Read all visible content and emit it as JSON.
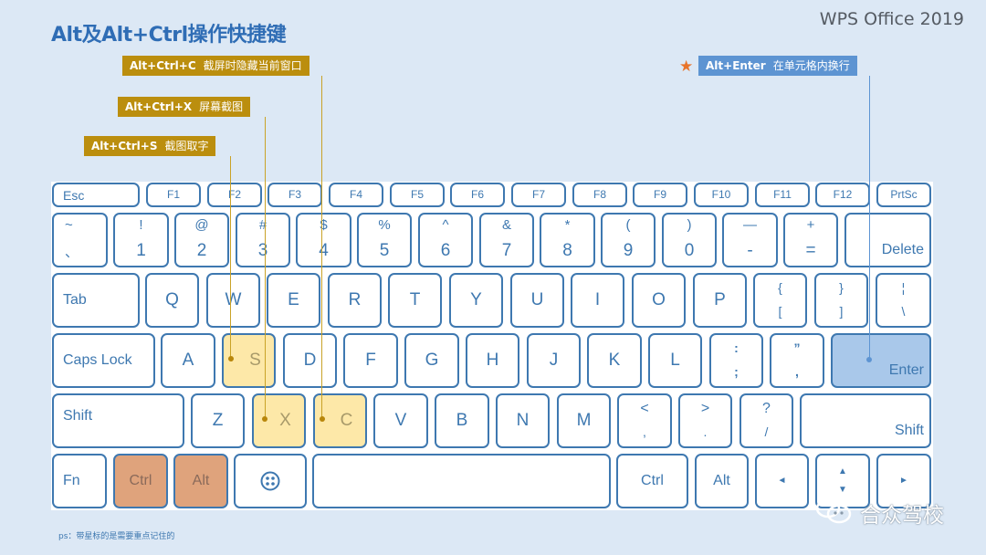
{
  "header": {
    "title": "Alt及Alt+Ctrl操作快捷键",
    "brand": "WPS Office 2019"
  },
  "callouts": [
    {
      "keys": "Alt+Ctrl+C",
      "desc": "截屏时隐藏当前窗口",
      "target": "C",
      "starred": false
    },
    {
      "keys": "Alt+Ctrl+X",
      "desc": "屏幕截图",
      "target": "X",
      "starred": false
    },
    {
      "keys": "Alt+Ctrl+S",
      "desc": "截图取字",
      "target": "S",
      "starred": false
    },
    {
      "keys": "Alt+Enter",
      "desc": "在单元格内换行",
      "target": "Enter",
      "starred": true
    }
  ],
  "keyboard": {
    "function_row": [
      "Esc",
      "F1",
      "F2",
      "F3",
      "F4",
      "F5",
      "F6",
      "F7",
      "F8",
      "F9",
      "F10",
      "F11",
      "F12",
      "PrtSc"
    ],
    "number_row": [
      {
        "top": "~",
        "bot": "、"
      },
      {
        "top": "!",
        "bot": "1"
      },
      {
        "top": "@",
        "bot": "2"
      },
      {
        "top": "#",
        "bot": "3"
      },
      {
        "top": "$",
        "bot": "4"
      },
      {
        "top": "%",
        "bot": "5"
      },
      {
        "top": "^",
        "bot": "6"
      },
      {
        "top": "&",
        "bot": "7"
      },
      {
        "top": "*",
        "bot": "8"
      },
      {
        "top": "(",
        "bot": "9"
      },
      {
        "top": ")",
        "bot": "0"
      },
      {
        "top": "—",
        "bot": "-"
      },
      {
        "top": "+",
        "bot": "="
      },
      {
        "top": "",
        "bot": "Delete"
      }
    ],
    "tab_row": [
      "Tab",
      "Q",
      "W",
      "E",
      "R",
      "T",
      "Y",
      "U",
      "I",
      "O",
      "P",
      {
        "top": "{",
        "bot": "["
      },
      {
        "top": "}",
        "bot": "]"
      },
      {
        "top": "¦",
        "bot": "\\"
      }
    ],
    "caps_row": [
      "Caps Lock",
      "A",
      "S",
      "D",
      "F",
      "G",
      "H",
      "J",
      "K",
      "L",
      {
        "top": ":",
        "bot": ";"
      },
      {
        "top": "”",
        "bot": ","
      },
      "Enter"
    ],
    "shift_row": [
      "Shift",
      "Z",
      "X",
      "C",
      "V",
      "B",
      "N",
      "M",
      {
        "top": "<",
        "bot": ","
      },
      {
        "top": ">",
        "bot": "."
      },
      {
        "top": "?",
        "bot": "/"
      },
      "Shift"
    ],
    "bottom_row": [
      "Fn",
      "Ctrl",
      "Alt",
      "windows-menu-icon",
      "",
      "Ctrl",
      "Alt",
      "◄",
      "▲",
      "▼",
      "►"
    ],
    "highlighted": {
      "yellow": [
        "S",
        "X",
        "C"
      ],
      "orange": [
        "Ctrl (left)",
        "Alt (left)"
      ],
      "blue": [
        "Enter"
      ]
    }
  },
  "colors": {
    "title": "#2f6db5",
    "key_border": "#3e78b0",
    "callout_gold": "#bb8e0e",
    "callout_blue": "#5d94d2",
    "highlight_yellow": "#fde8a8",
    "highlight_orange": "#dfa37c",
    "highlight_blue": "#a9c8ea",
    "star": "#e8742a",
    "background": "#dce8f5"
  },
  "footer": {
    "note": "ps：带星标的是需要重点记住的",
    "watermark": "合众驾校"
  }
}
